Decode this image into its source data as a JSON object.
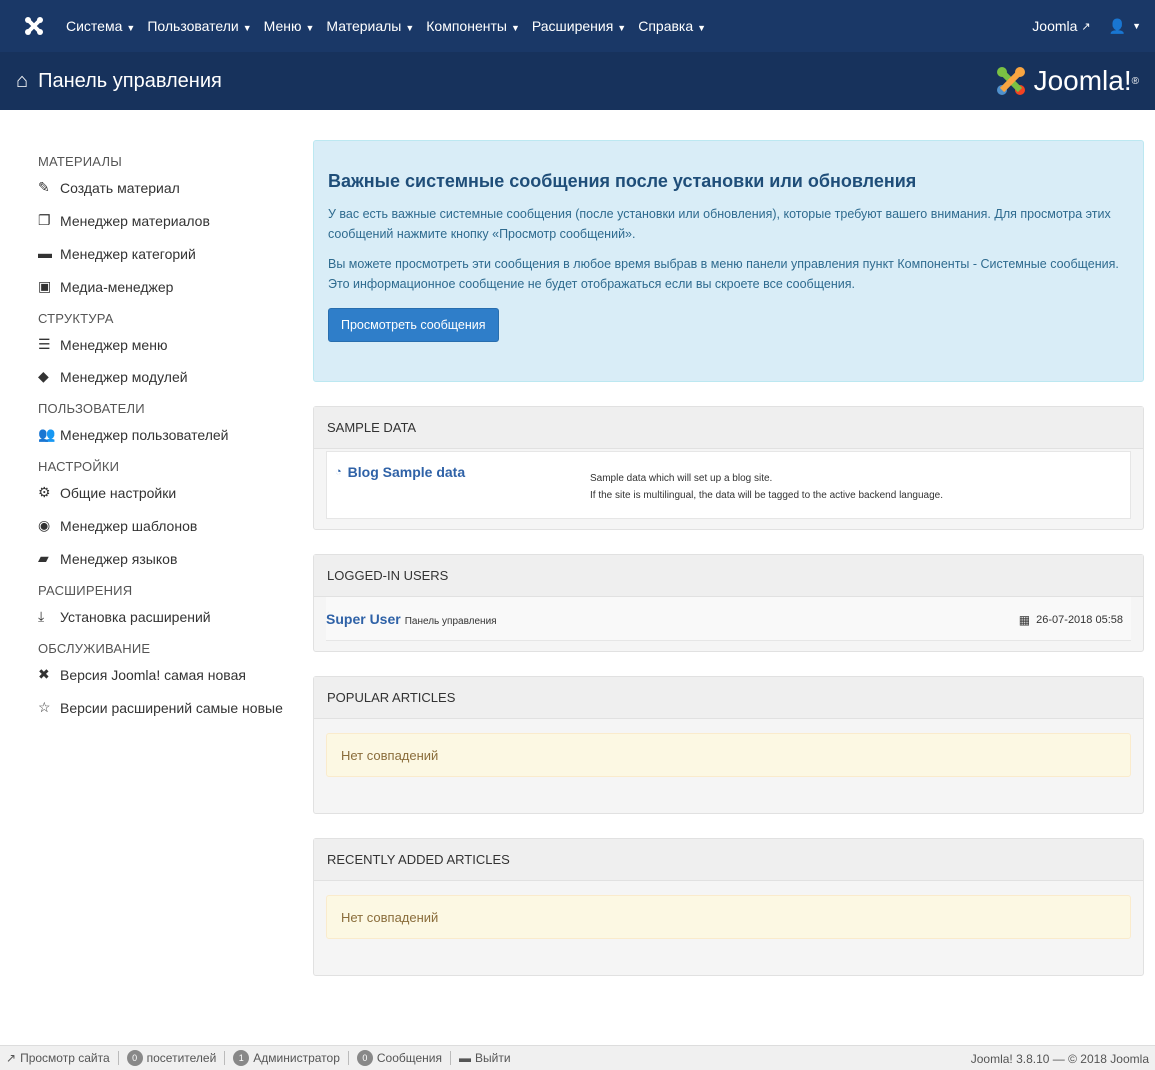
{
  "navbar": {
    "logo_icon": "joomla-icon",
    "menu": [
      {
        "label": "Система",
        "id": "system"
      },
      {
        "label": "Пользователи",
        "id": "users"
      },
      {
        "label": "Меню",
        "id": "menus"
      },
      {
        "label": "Материалы",
        "id": "content"
      },
      {
        "label": "Компоненты",
        "id": "components"
      },
      {
        "label": "Расширения",
        "id": "extensions"
      },
      {
        "label": "Справка",
        "id": "help"
      }
    ],
    "site_link": "Joomla",
    "user_icon": "user-icon"
  },
  "header": {
    "title": "Панель управления",
    "brand": "Joomla!",
    "brand_sup": "®"
  },
  "sidebar": {
    "sections": [
      {
        "heading": "МАТЕРИАЛЫ",
        "items": [
          {
            "label": "Создать материал",
            "icon": "pencil-icon"
          },
          {
            "label": "Менеджер материалов",
            "icon": "copy-icon"
          },
          {
            "label": "Менеджер категорий",
            "icon": "folder-icon"
          },
          {
            "label": "Медиа-менеджер",
            "icon": "image-icon"
          }
        ]
      },
      {
        "heading": "СТРУКТУРА",
        "items": [
          {
            "label": "Менеджер меню",
            "icon": "list-icon"
          },
          {
            "label": "Менеджер модулей",
            "icon": "cube-icon"
          }
        ]
      },
      {
        "heading": "ПОЛЬЗОВАТЕЛИ",
        "items": [
          {
            "label": "Менеджер пользователей",
            "icon": "users-icon"
          }
        ]
      },
      {
        "heading": "НАСТРОЙКИ",
        "items": [
          {
            "label": "Общие настройки",
            "icon": "cog-icon"
          },
          {
            "label": "Менеджер шаблонов",
            "icon": "eye-icon"
          },
          {
            "label": "Менеджер языков",
            "icon": "comments-icon"
          }
        ]
      },
      {
        "heading": "РАСШИРЕНИЯ",
        "items": [
          {
            "label": "Установка расширений",
            "icon": "download-icon"
          }
        ]
      },
      {
        "heading": "ОБСЛУЖИВАНИЕ",
        "items": [
          {
            "label": "Версия Joomla! самая новая",
            "icon": "joomla-icon"
          },
          {
            "label": "Версии расширений самые новые",
            "icon": "star-icon"
          }
        ]
      }
    ]
  },
  "alert": {
    "title": "Важные системные сообщения после установки или обновления",
    "p1": "У вас есть важные системные сообщения (после установки или обновления), которые требуют вашего внимания. Для просмотра этих сообщений нажмите кнопку «Просмотр сообщений».",
    "p2": "Вы можете просмотреть эти сообщения в любое время выбрав в меню панели управления пункт Компоненты - Системные сообщения. Это информационное сообщение не будет отображаться если вы скроете все сообщения.",
    "button": "Просмотреть сообщения"
  },
  "sample_data": {
    "title": "SAMPLE DATA",
    "item_label": "Blog Sample data",
    "item_icon": "wifi-icon",
    "desc1": "Sample data which will set up a blog site.",
    "desc2": "If the site is multilingual, the data will be tagged to the active backend language."
  },
  "logged_in": {
    "title": "LOGGED-IN USERS",
    "user": "Super User",
    "context": "Панель управления",
    "time": "26-07-2018 05:58",
    "time_icon": "calendar-icon"
  },
  "popular": {
    "title": "POPULAR ARTICLES",
    "empty": "Нет совпадений"
  },
  "recent": {
    "title": "RECENTLY ADDED ARTICLES",
    "empty": "Нет совпадений"
  },
  "footer": {
    "view_site": "Просмотр сайта",
    "visitors_count": "0",
    "visitors_label": "посетителей",
    "admins_count": "1",
    "admins_label": "Администратор",
    "messages_count": "0",
    "messages_label": "Сообщения",
    "logout": "Выйти",
    "version": "Joomla! 3.8.10 — © 2018 Joomla"
  }
}
